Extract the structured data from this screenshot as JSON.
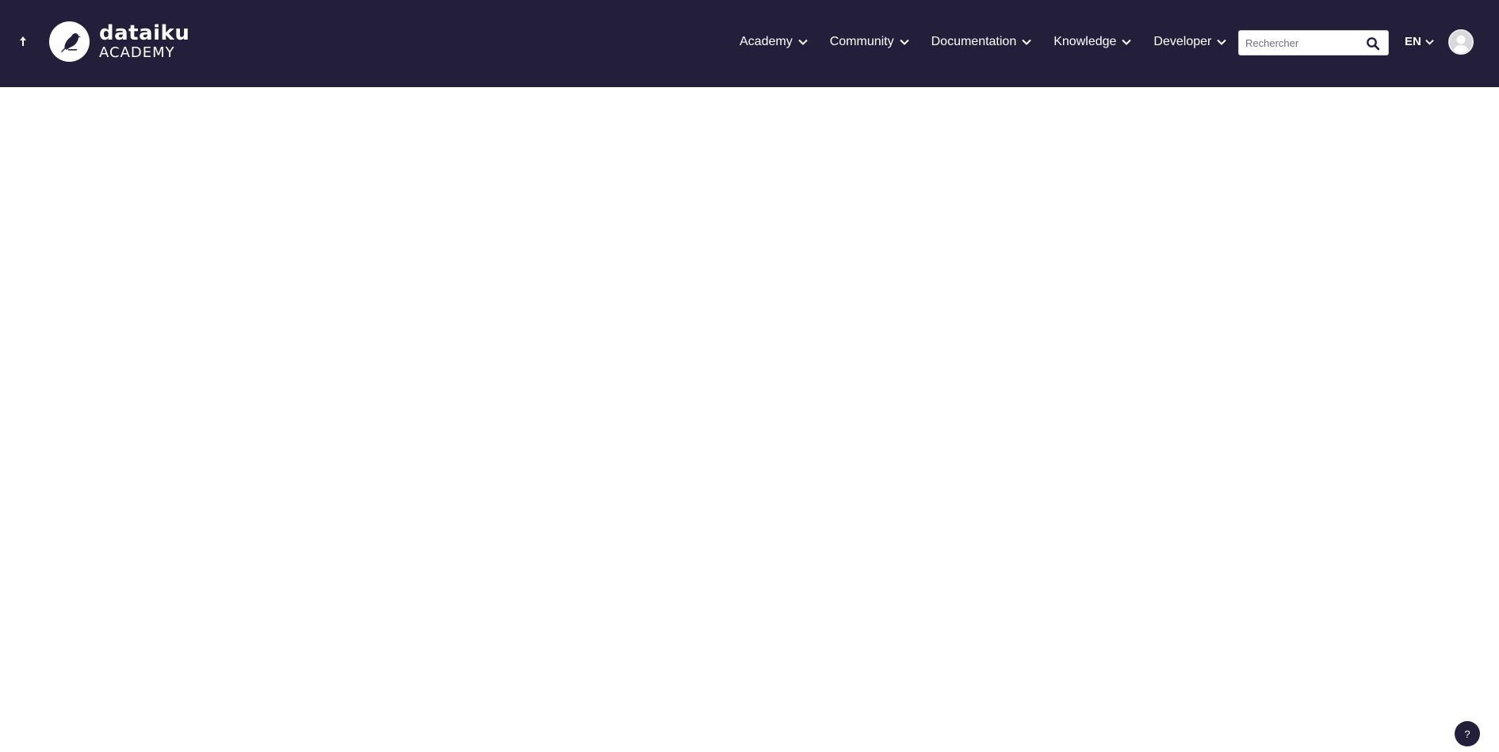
{
  "header": {
    "back_icon": "arrow-up-icon",
    "logo": {
      "brand": "dataiku",
      "subtitle": "ACADEMY",
      "icon": "bird-icon"
    },
    "nav": [
      {
        "label": "Academy"
      },
      {
        "label": "Community"
      },
      {
        "label": "Documentation"
      },
      {
        "label": "Knowledge"
      },
      {
        "label": "Developer"
      }
    ],
    "search": {
      "placeholder": "Rechercher",
      "value": "",
      "icon": "search-icon"
    },
    "language": {
      "label": "EN"
    },
    "avatar": {
      "icon": "user-avatar-icon"
    }
  },
  "help": {
    "label": "?"
  },
  "colors": {
    "header_bg": "#231f3a",
    "page_bg": "#ffffff",
    "text_on_header": "#ffffff"
  }
}
